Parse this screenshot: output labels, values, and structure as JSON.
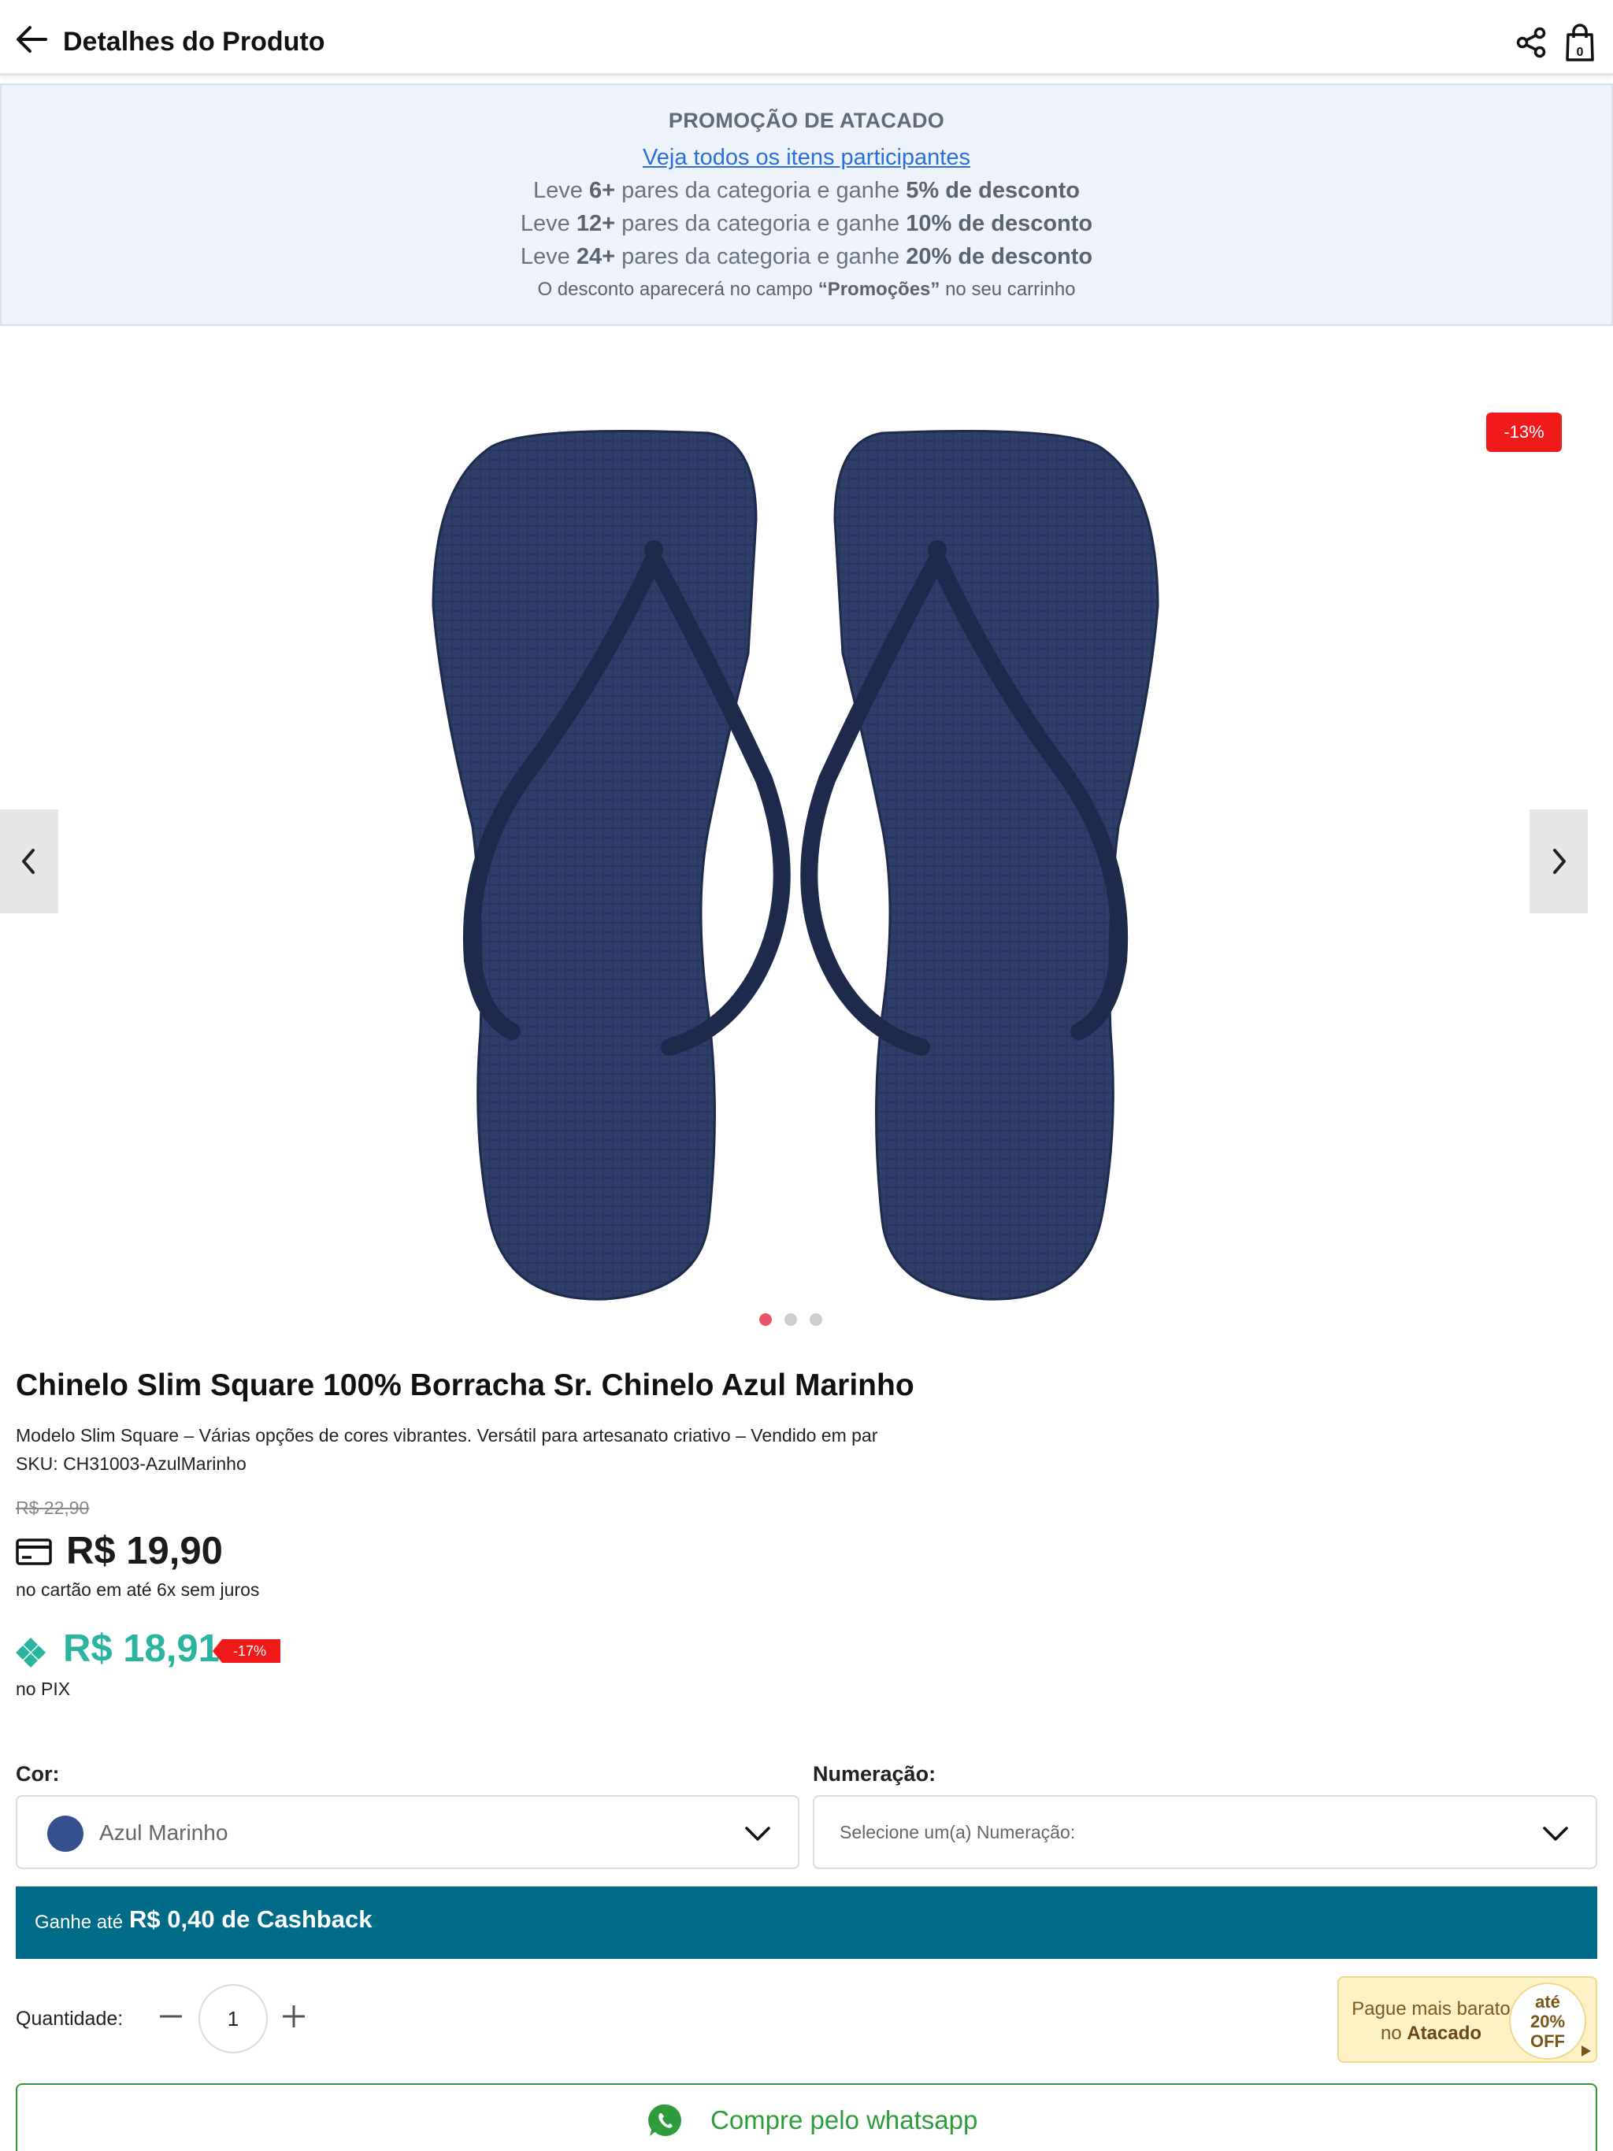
{
  "header": {
    "title": "Detalhes do Produto"
  },
  "promo": {
    "title": "PROMOÇÃO DE ATACADO",
    "link": "Veja todos os itens participantes",
    "tiers": [
      {
        "prefix": "Leve ",
        "qty": "6+",
        "middle": " pares da categoria e ganhe ",
        "discount": "5% de desconto"
      },
      {
        "prefix": "Leve ",
        "qty": "12+",
        "middle": " pares da categoria e ganhe ",
        "discount": "10% de desconto"
      },
      {
        "prefix": "Leve ",
        "qty": "24+",
        "middle": " pares da categoria e ganhe ",
        "discount": "20% de desconto"
      }
    ],
    "note_prefix": "O desconto aparecerá no campo ",
    "note_field": "“Promoções”",
    "note_suffix": " no seu carrinho"
  },
  "gallery": {
    "discount_badge": "-13%",
    "image_count": 3,
    "active_index": 0,
    "colors": {
      "sandal": "#2f3f69",
      "dot_active": "#e8556b",
      "dot_inactive": "#cfcfcf"
    }
  },
  "product": {
    "name": "Chinelo Slim Square 100% Borracha Sr. Chinelo Azul Marinho",
    "description": "Modelo Slim Square – Várias opções de cores vibrantes. Versátil para artesanato criativo – Vendido em par",
    "sku": "SKU: CH31003-AzulMarinho",
    "old_price": "R$ 22,90",
    "card_price": "R$ 19,90",
    "card_terms": "no cartão em até 6x sem juros",
    "pix_price": "R$ 18,91",
    "pix_discount": "-17%",
    "pix_label": "no PIX"
  },
  "options": {
    "color_label": "Cor:",
    "color_value": "Azul Marinho",
    "color_swatch": "#35508e",
    "size_label": "Numeração:",
    "size_placeholder": "Selecione um(a) Numeração:"
  },
  "cashback": {
    "prefix": "Ganhe até",
    "amount": "R$ 0,40 de Cashback"
  },
  "quantity": {
    "label": "Quantidade:",
    "value": "1"
  },
  "wholesale_badge": {
    "line1": "Pague mais barato",
    "line2_prefix": "no ",
    "line2_bold": "Atacado",
    "circle_line1": "até",
    "circle_line2": "20%",
    "circle_line3": "OFF"
  },
  "whatsapp": {
    "label": "Compre pelo whatsapp"
  },
  "colors": {
    "pix": "#2bb5a0",
    "cashback_bg": "#006c88",
    "badge_red": "#f01a1a",
    "whatsapp_green": "#2e9c3c",
    "link_blue": "#2b6fd6"
  }
}
